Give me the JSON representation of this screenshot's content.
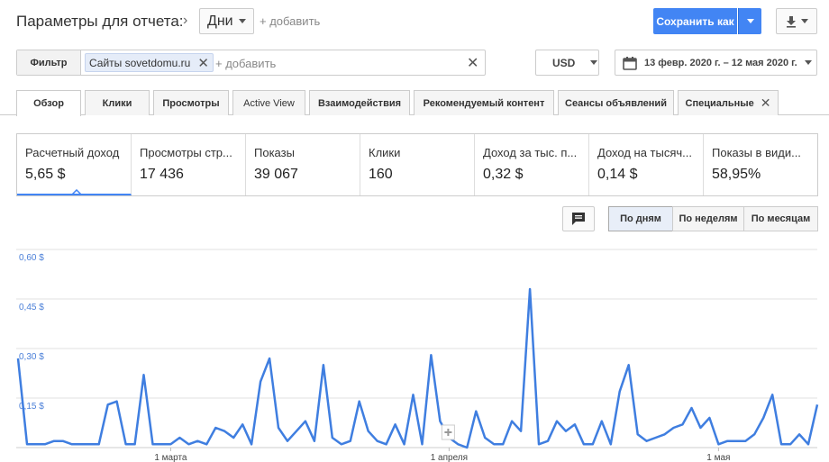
{
  "header": {
    "title": "Параметры для отчета:",
    "chevron": "›",
    "dimension_dropdown": "Дни",
    "add_dimension": "+ добавить",
    "save_button": "Сохранить как"
  },
  "filter": {
    "label": "Фильтр",
    "chip": "Сайты sovetdomu.ru",
    "add": "+ добавить"
  },
  "currency": "USD",
  "date_range": "13 февр. 2020 г. – 12 мая 2020 г.",
  "tabs": [
    "Обзор",
    "Клики",
    "Просмотры",
    "Active View",
    "Взаимодействия",
    "Рекомендуемый контент",
    "Сеансы объявлений",
    "Специальные"
  ],
  "metrics": [
    {
      "label": "Расчетный доход",
      "value": "5,65 $"
    },
    {
      "label": "Просмотры стр...",
      "value": "17 436"
    },
    {
      "label": "Показы",
      "value": "39 067"
    },
    {
      "label": "Клики",
      "value": "160"
    },
    {
      "label": "Доход за тыс. п...",
      "value": "0,32 $"
    },
    {
      "label": "Доход на тысяч...",
      "value": "0,14 $"
    },
    {
      "label": "Показы в види...",
      "value": "58,95%"
    }
  ],
  "granularity": [
    "По дням",
    "По неделям",
    "По месяцам"
  ],
  "colors": {
    "accent": "#4285f4",
    "line": "#3f7ee0"
  },
  "icons": {
    "annotations": "comment-icon",
    "download": "download-icon",
    "calendar": "calendar-icon"
  },
  "chart_data": {
    "type": "line",
    "ylabel": "",
    "ylim": [
      0,
      0.6
    ],
    "y_ticks": [
      "0,60 $",
      "0,45 $",
      "0,30 $",
      "0,15 $"
    ],
    "y_tick_values": [
      0.6,
      0.45,
      0.3,
      0.15
    ],
    "x_ticks": [
      {
        "label": "1 марта",
        "index": 17
      },
      {
        "label": "1 апреля",
        "index": 48
      },
      {
        "label": "1 мая",
        "index": 78
      }
    ],
    "series": [
      {
        "values": [
          0.27,
          0.01,
          0.01,
          0.01,
          0.02,
          0.02,
          0.01,
          0.01,
          0.01,
          0.01,
          0.13,
          0.14,
          0.01,
          0.01,
          0.22,
          0.01,
          0.01,
          0.01,
          0.03,
          0.01,
          0.02,
          0.01,
          0.06,
          0.05,
          0.03,
          0.07,
          0.01,
          0.2,
          0.27,
          0.06,
          0.02,
          0.05,
          0.08,
          0.02,
          0.25,
          0.03,
          0.01,
          0.02,
          0.14,
          0.05,
          0.02,
          0.01,
          0.07,
          0.01,
          0.16,
          0.01,
          0.28,
          0.08,
          0.03,
          0.01,
          0,
          0.11,
          0.03,
          0.01,
          0.01,
          0.08,
          0.05,
          0.48,
          0.01,
          0.02,
          0.08,
          0.05,
          0.07,
          0.01,
          0.01,
          0.08,
          0.01,
          0.17,
          0.25,
          0.04,
          0.02,
          0.03,
          0.04,
          0.06,
          0.07,
          0.12,
          0.06,
          0.09,
          0.01,
          0.02,
          0.02,
          0.02,
          0.04,
          0.09,
          0.16,
          0.01,
          0.01,
          0.04,
          0.01,
          0.13
        ]
      }
    ]
  }
}
